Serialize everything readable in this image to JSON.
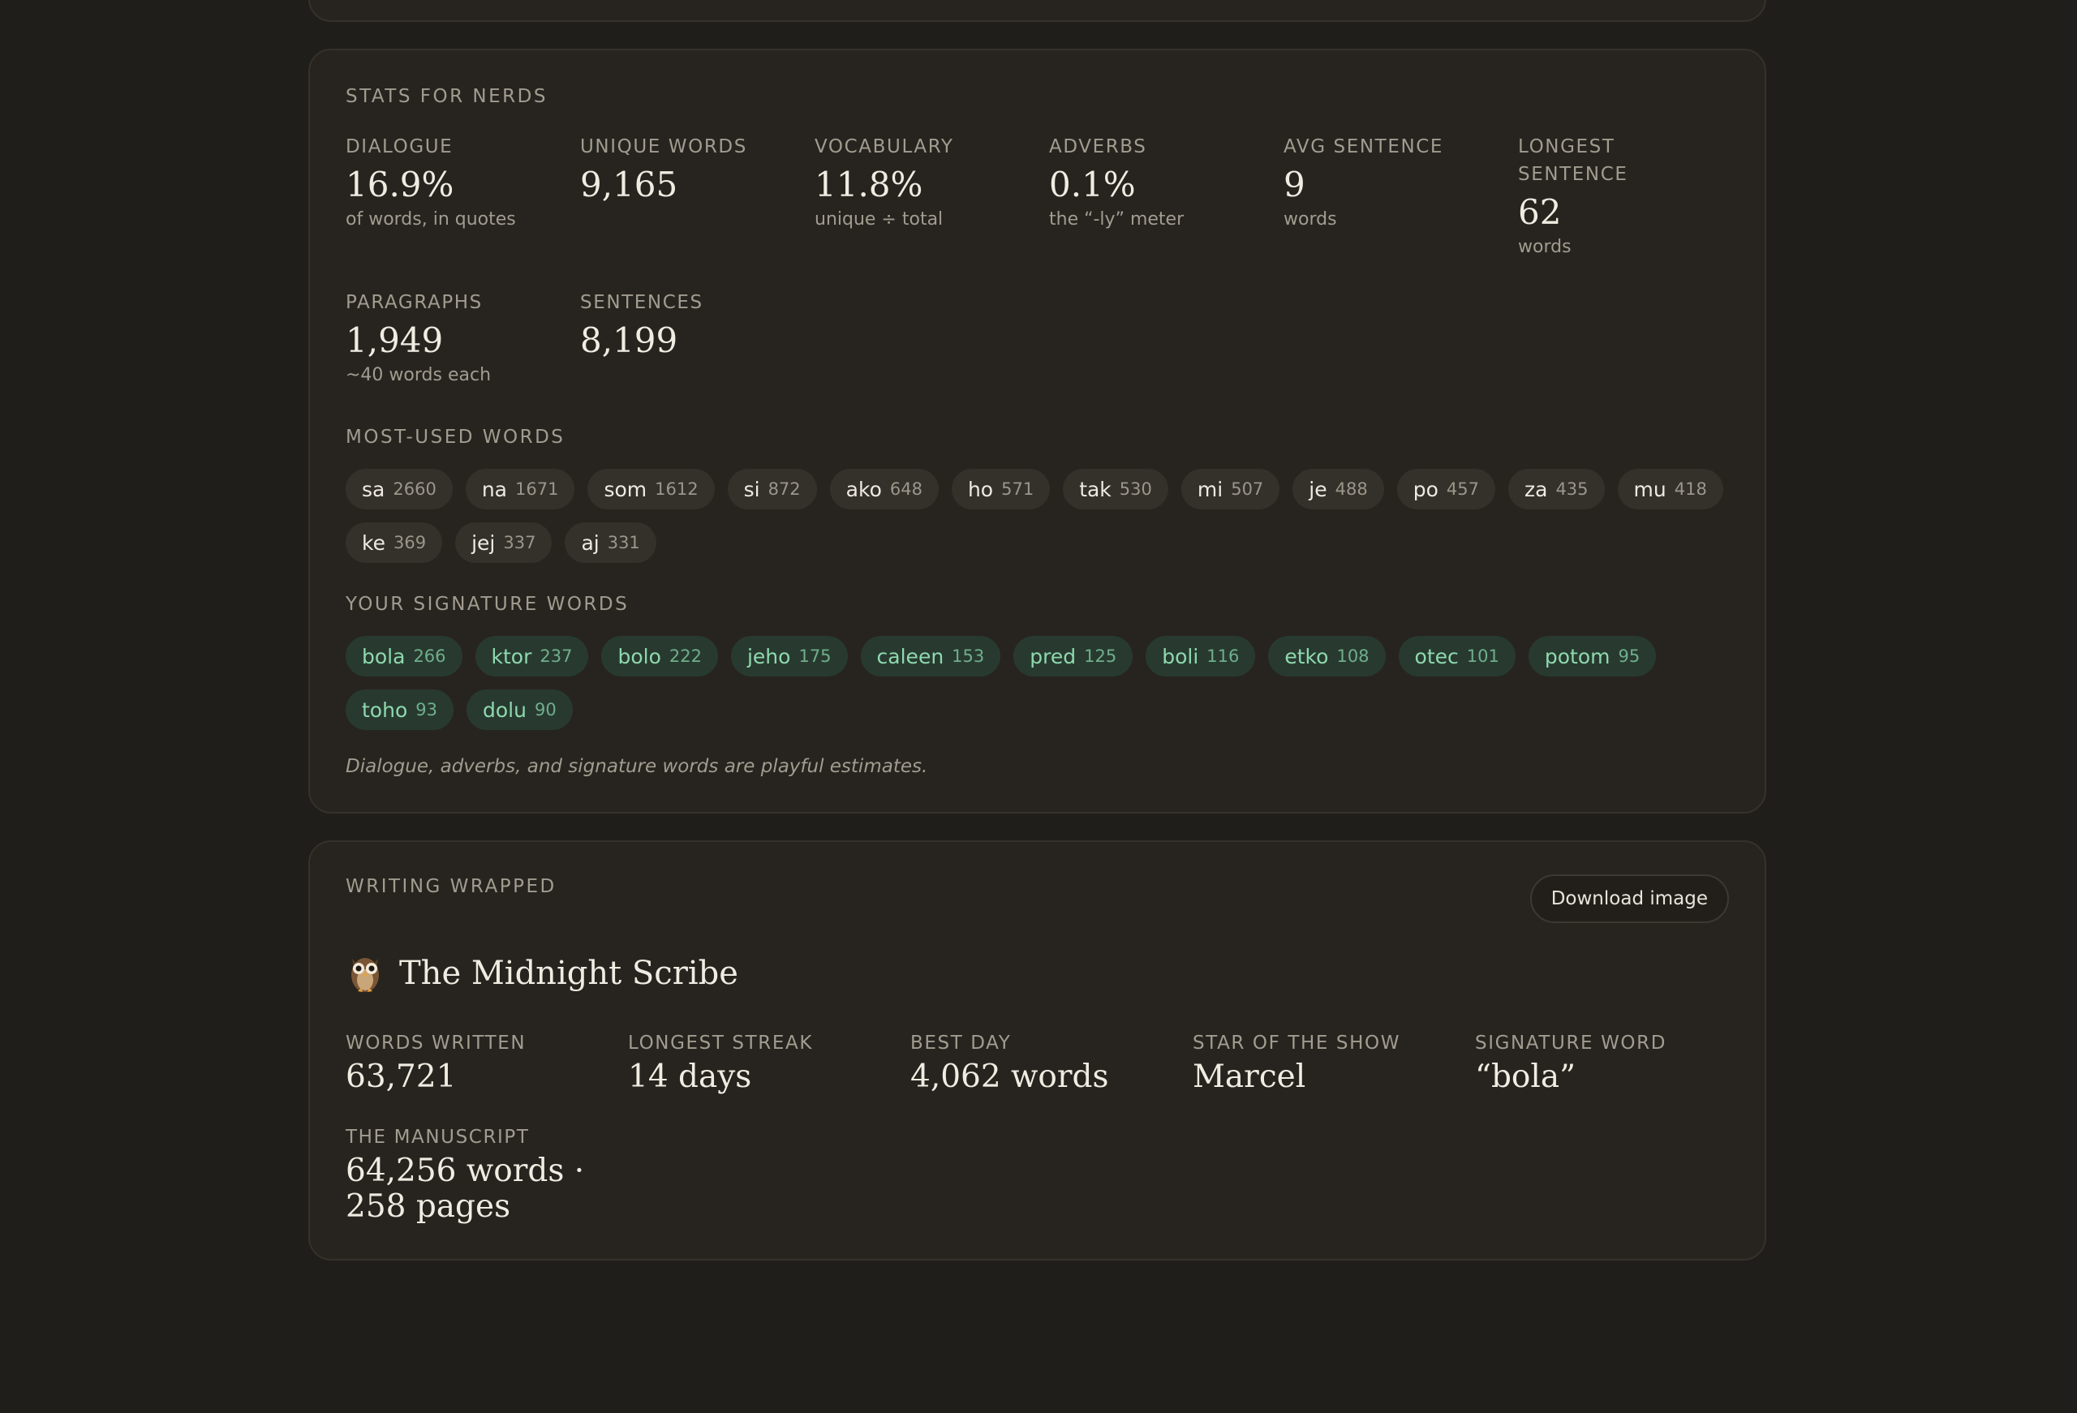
{
  "stats": {
    "title": "STATS FOR NERDS",
    "items": [
      {
        "label": "DIALOGUE",
        "value": "16.9%",
        "sub": "of words, in quotes"
      },
      {
        "label": "UNIQUE WORDS",
        "value": "9,165",
        "sub": ""
      },
      {
        "label": "VOCABULARY",
        "value": "11.8%",
        "sub": "unique ÷ total"
      },
      {
        "label": "ADVERBS",
        "value": "0.1%",
        "sub": "the “-ly” meter"
      },
      {
        "label": "AVG SENTENCE",
        "value": "9",
        "sub": "words"
      },
      {
        "label": "LONGEST SENTENCE",
        "value": "62",
        "sub": "words"
      },
      {
        "label": "PARAGRAPHS",
        "value": "1,949",
        "sub": "~40 words each"
      },
      {
        "label": "SENTENCES",
        "value": "8,199",
        "sub": ""
      }
    ],
    "most_used_title": "MOST-USED WORDS",
    "most_used": [
      {
        "word": "sa",
        "count": "2660"
      },
      {
        "word": "na",
        "count": "1671"
      },
      {
        "word": "som",
        "count": "1612"
      },
      {
        "word": "si",
        "count": "872"
      },
      {
        "word": "ako",
        "count": "648"
      },
      {
        "word": "ho",
        "count": "571"
      },
      {
        "word": "tak",
        "count": "530"
      },
      {
        "word": "mi",
        "count": "507"
      },
      {
        "word": "je",
        "count": "488"
      },
      {
        "word": "po",
        "count": "457"
      },
      {
        "word": "za",
        "count": "435"
      },
      {
        "word": "mu",
        "count": "418"
      },
      {
        "word": "ke",
        "count": "369"
      },
      {
        "word": "jej",
        "count": "337"
      },
      {
        "word": "aj",
        "count": "331"
      }
    ],
    "signature_title": "YOUR SIGNATURE WORDS",
    "signature": [
      {
        "word": "bola",
        "count": "266"
      },
      {
        "word": "ktor",
        "count": "237"
      },
      {
        "word": "bolo",
        "count": "222"
      },
      {
        "word": "jeho",
        "count": "175"
      },
      {
        "word": "caleen",
        "count": "153"
      },
      {
        "word": "pred",
        "count": "125"
      },
      {
        "word": "boli",
        "count": "116"
      },
      {
        "word": "etko",
        "count": "108"
      },
      {
        "word": "otec",
        "count": "101"
      },
      {
        "word": "potom",
        "count": "95"
      },
      {
        "word": "toho",
        "count": "93"
      },
      {
        "word": "dolu",
        "count": "90"
      }
    ],
    "note": "Dialogue, adverbs, and signature words are playful estimates."
  },
  "wrapped": {
    "title": "WRITING WRAPPED",
    "download_label": "Download image",
    "persona_icon": "owl-icon",
    "persona_title": "The Midnight Scribe",
    "items": [
      {
        "label": "WORDS WRITTEN",
        "value": "63,721"
      },
      {
        "label": "LONGEST STREAK",
        "value": "14 days"
      },
      {
        "label": "BEST DAY",
        "value": "4,062 words"
      },
      {
        "label": "STAR OF THE SHOW",
        "value": "Marcel"
      },
      {
        "label": "SIGNATURE WORD",
        "value": "“bola”"
      },
      {
        "label": "THE MANUSCRIPT",
        "value": "64,256 words · 258 pages"
      }
    ]
  },
  "colors": {
    "background": "#201e1a",
    "card": "#27241f",
    "accent_green": "#8ed9ae",
    "muted": "#a29c90"
  }
}
